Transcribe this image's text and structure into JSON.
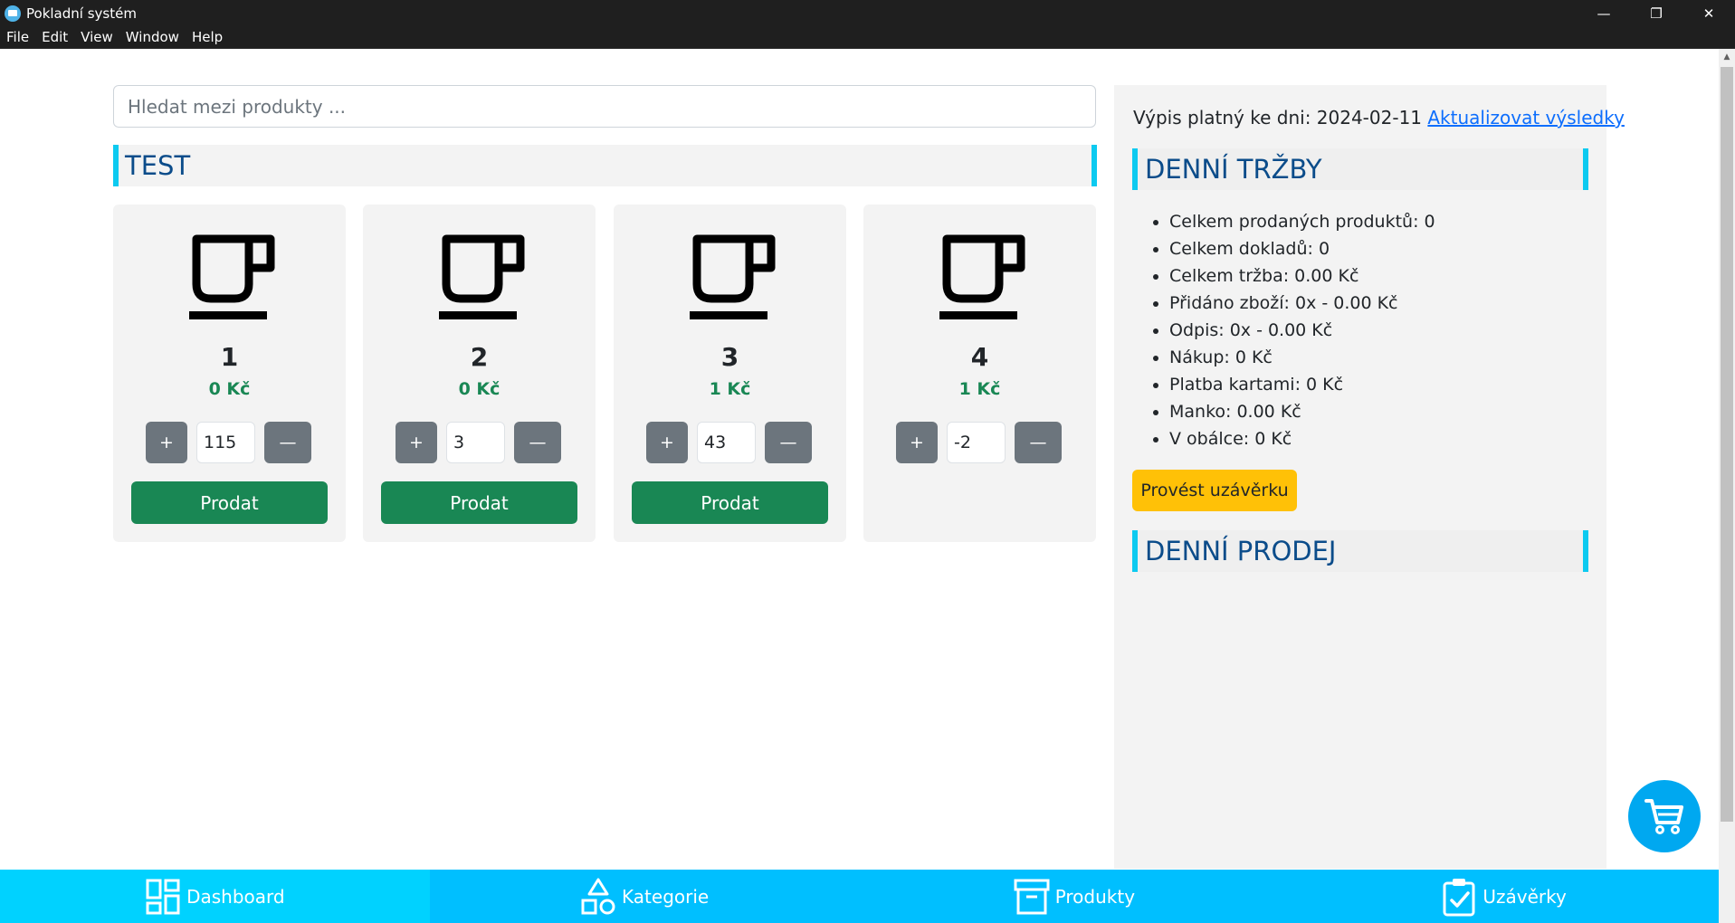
{
  "window": {
    "title": "Pokladní systém",
    "controls": {
      "minimize": "—",
      "restore": "❐",
      "close": "✕"
    }
  },
  "menu": [
    "File",
    "Edit",
    "View",
    "Window",
    "Help"
  ],
  "search": {
    "placeholder": "Hledat mezi produkty ..."
  },
  "category": {
    "name": "TEST"
  },
  "products": [
    {
      "name": "1",
      "price": "0 Kč",
      "quantity": "115",
      "sell_label": "Prodat",
      "plus_label": "+",
      "minus_label": "—"
    },
    {
      "name": "2",
      "price": "0 Kč",
      "quantity": "3",
      "sell_label": "Prodat",
      "plus_label": "+",
      "minus_label": "—"
    },
    {
      "name": "3",
      "price": "1 Kč",
      "quantity": "43",
      "sell_label": "Prodat",
      "plus_label": "+",
      "minus_label": "—"
    },
    {
      "name": "4",
      "price": "1 Kč",
      "quantity": "-2",
      "plus_label": "+",
      "minus_label": "—"
    }
  ],
  "summary": {
    "valid_prefix": "Výpis platný ke dni: 2024-02-11",
    "refresh_link": "Aktualizovat výsledky",
    "daily_revenue_title": "DENNÍ TRŽBY",
    "stats": [
      "Celkem prodaných produktů: 0",
      "Celkem dokladů: 0",
      "Celkem tržba: 0.00 Kč",
      "Přidáno zboží: 0x - 0.00 Kč",
      "Odpis: 0x - 0.00 Kč",
      "Nákup: 0 Kč",
      "Platba kartami: 0 Kč",
      "Manko: 0.00 Kč",
      "V obálce: 0 Kč"
    ],
    "close_button": "Provést uzávěrku",
    "daily_sales_title": "DENNÍ PRODEJ"
  },
  "nav": [
    {
      "label": "Dashboard",
      "icon": "dashboard-icon",
      "active": true
    },
    {
      "label": "Kategorie",
      "icon": "shapes-icon",
      "active": false
    },
    {
      "label": "Produkty",
      "icon": "archive-box-icon",
      "active": false
    },
    {
      "label": "Uzávěrky",
      "icon": "clipboard-check-icon",
      "active": false
    }
  ],
  "colors": {
    "accent_cyan": "#0dcaf0",
    "nav_blue": "#00bfff",
    "sell_green": "#198754",
    "stepper_gray": "#6c757d",
    "close_yellow": "#ffc107",
    "heading_blue": "#0b4c8a",
    "cart_blue": "#00a8f0"
  }
}
